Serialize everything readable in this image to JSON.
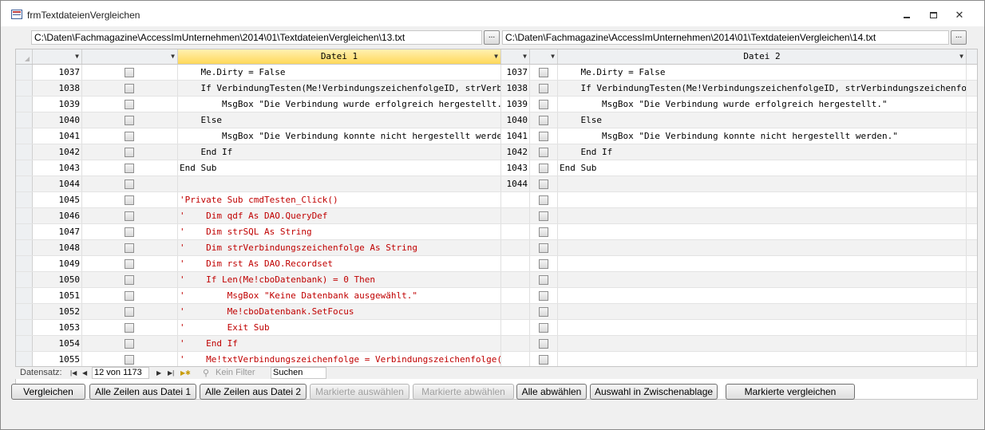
{
  "window": {
    "title": "frmTextdateienVergleichen"
  },
  "paths": {
    "left": "C:\\Daten\\Fachmagazine\\AccessImUnternehmen\\2014\\01\\TextdateienVergleichen\\13.txt",
    "right": "C:\\Daten\\Fachmagazine\\AccessImUnternehmen\\2014\\01\\TextdateienVergleichen\\14.txt",
    "browse_label": "..."
  },
  "columns": {
    "file1": "Datei 1",
    "file2": "Datei 2"
  },
  "rows": [
    {
      "n1": "1037",
      "c1": "    Me.Dirty = False",
      "red": false,
      "n2": "1037",
      "c2": "    Me.Dirty = False"
    },
    {
      "n1": "1038",
      "c1": "    If VerbindungTesten(Me!VerbindungszeichenfolgeID, strVerbindungszeichenfolge) Then",
      "red": false,
      "n2": "1038",
      "c2": "    If VerbindungTesten(Me!VerbindungszeichenfolgeID, strVerbindungszeichenfolge) Then"
    },
    {
      "n1": "1039",
      "c1": "        MsgBox \"Die Verbindung wurde erfolgreich hergestellt.\"",
      "red": false,
      "n2": "1039",
      "c2": "        MsgBox \"Die Verbindung wurde erfolgreich hergestellt.\""
    },
    {
      "n1": "1040",
      "c1": "    Else",
      "red": false,
      "n2": "1040",
      "c2": "    Else"
    },
    {
      "n1": "1041",
      "c1": "        MsgBox \"Die Verbindung konnte nicht hergestellt werden.\"",
      "red": false,
      "n2": "1041",
      "c2": "        MsgBox \"Die Verbindung konnte nicht hergestellt werden.\""
    },
    {
      "n1": "1042",
      "c1": "    End If",
      "red": false,
      "n2": "1042",
      "c2": "    End If"
    },
    {
      "n1": "1043",
      "c1": "End Sub",
      "red": false,
      "n2": "1043",
      "c2": "End Sub"
    },
    {
      "n1": "1044",
      "c1": "",
      "red": false,
      "n2": "1044",
      "c2": ""
    },
    {
      "n1": "1045",
      "c1": "'Private Sub cmdTesten_Click()",
      "red": true,
      "n2": "",
      "c2": ""
    },
    {
      "n1": "1046",
      "c1": "'    Dim qdf As DAO.QueryDef",
      "red": true,
      "n2": "",
      "c2": ""
    },
    {
      "n1": "1047",
      "c1": "'    Dim strSQL As String",
      "red": true,
      "n2": "",
      "c2": ""
    },
    {
      "n1": "1048",
      "c1": "'    Dim strVerbindungszeichenfolge As String",
      "red": true,
      "n2": "",
      "c2": ""
    },
    {
      "n1": "1049",
      "c1": "'    Dim rst As DAO.Recordset",
      "red": true,
      "n2": "",
      "c2": ""
    },
    {
      "n1": "1050",
      "c1": "'    If Len(Me!cboDatenbank) = 0 Then",
      "red": true,
      "n2": "",
      "c2": ""
    },
    {
      "n1": "1051",
      "c1": "'        MsgBox \"Keine Datenbank ausgewählt.\"",
      "red": true,
      "n2": "",
      "c2": ""
    },
    {
      "n1": "1052",
      "c1": "'        Me!cboDatenbank.SetFocus",
      "red": true,
      "n2": "",
      "c2": ""
    },
    {
      "n1": "1053",
      "c1": "'        Exit Sub",
      "red": true,
      "n2": "",
      "c2": ""
    },
    {
      "n1": "1054",
      "c1": "'    End If",
      "red": true,
      "n2": "",
      "c2": ""
    },
    {
      "n1": "1055",
      "c1": "'    Me!txtVerbindungszeichenfolge = Verbindungszeichenfolge(Me!cboDatenbank)",
      "red": true,
      "n2": "",
      "c2": ""
    }
  ],
  "nav": {
    "label": "Datensatz:",
    "record": "12 von 1173",
    "filter": "Kein Filter",
    "search": "Suchen"
  },
  "buttons": {
    "compare": "Vergleichen",
    "all_file1": "Alle Zeilen aus Datei 1",
    "all_file2": "Alle Zeilen aus Datei 2",
    "select_marked": "Markierte auswählen",
    "deselect_marked": "Markierte abwählen",
    "deselect_all": "Alle abwählen",
    "to_clipboard": "Auswahl in Zwischenablage",
    "compare_marked": "Markierte vergleichen"
  },
  "colors": {
    "changed_text": "#c00000",
    "active_header": "#ffd85a"
  }
}
